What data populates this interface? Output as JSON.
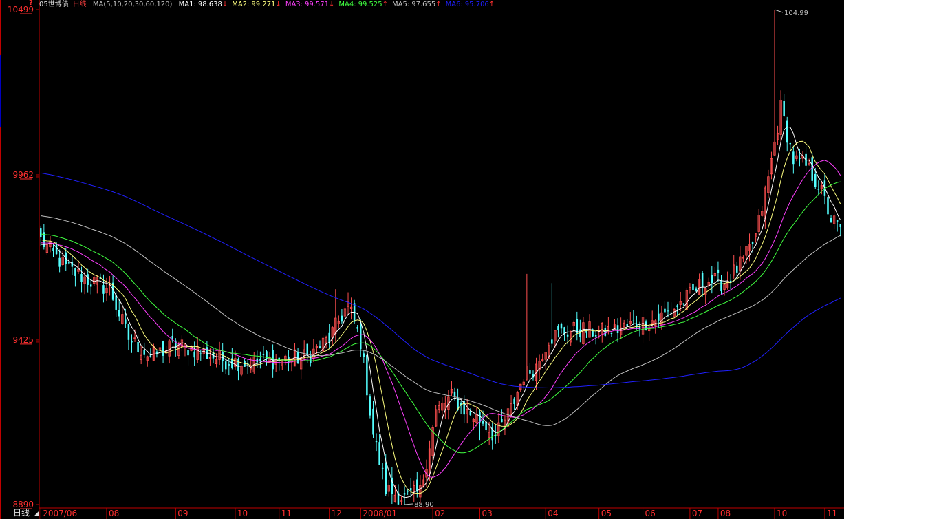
{
  "header": {
    "symbol": "05世博债",
    "period": "日线",
    "ma_label": "MA(5,10,20,30,60,120)",
    "mas": [
      {
        "label": "MA1:",
        "value": "98.638",
        "arrow": "↓",
        "color": "#ffffff"
      },
      {
        "label": "MA2:",
        "value": "99.271",
        "arrow": "↓",
        "color": "#ffff80"
      },
      {
        "label": "MA3:",
        "value": "99.571",
        "arrow": "↓",
        "color": "#ff40ff"
      },
      {
        "label": "MA4:",
        "value": "99.525",
        "arrow": "↑",
        "color": "#40ff40"
      },
      {
        "label": "MA5:",
        "value": "97.655",
        "arrow": "↑",
        "color": "#c0c0c0"
      },
      {
        "label": "MA6:",
        "value": "95.706",
        "arrow": "↑",
        "color": "#2020ff"
      }
    ]
  },
  "period_label": "日线",
  "colors": {
    "up": "#ff5050",
    "down": "#54ffff",
    "axis": "#c00000",
    "label": "#ff3030"
  },
  "chart_data": {
    "type": "candlestick",
    "y_ticks": [
      "10499",
      "9962",
      "9425",
      "8890"
    ],
    "y_tick_values": [
      104.99,
      99.62,
      94.25,
      88.9
    ],
    "ylim": [
      88.9,
      104.99
    ],
    "x_ticks": [
      {
        "label": "2007/06",
        "index": 0
      },
      {
        "label": "08",
        "index": 21
      },
      {
        "label": "09",
        "index": 43
      },
      {
        "label": "10",
        "index": 62
      },
      {
        "label": "11",
        "index": 76
      },
      {
        "label": "12",
        "index": 92
      },
      {
        "label": "2008/01",
        "index": 102
      },
      {
        "label": "02",
        "index": 125
      },
      {
        "label": "03",
        "index": 140
      },
      {
        "label": "04",
        "index": 161
      },
      {
        "label": "05",
        "index": 178
      },
      {
        "label": "06",
        "index": 192
      },
      {
        "label": "07",
        "index": 207
      },
      {
        "label": "08",
        "index": 216
      },
      {
        "label": "10",
        "index": 234
      },
      {
        "label": "11",
        "index": 250
      }
    ],
    "annotations": [
      {
        "text": "104.99",
        "index": 234,
        "value": 104.99
      },
      {
        "text": "88.90",
        "index": 116,
        "value": 88.9
      }
    ],
    "anchors": [
      [
        0,
        97.5
      ],
      [
        8,
        96.6
      ],
      [
        15,
        96.2
      ],
      [
        22,
        95.9
      ],
      [
        28,
        94.3
      ],
      [
        35,
        93.7
      ],
      [
        43,
        94.1
      ],
      [
        50,
        93.9
      ],
      [
        58,
        93.6
      ],
      [
        66,
        93.5
      ],
      [
        75,
        93.6
      ],
      [
        85,
        93.7
      ],
      [
        92,
        94.3
      ],
      [
        98,
        95.4
      ],
      [
        102,
        94.2
      ],
      [
        106,
        91.2
      ],
      [
        110,
        89.4
      ],
      [
        116,
        89.1
      ],
      [
        121,
        89.3
      ],
      [
        126,
        91.9
      ],
      [
        131,
        92.4
      ],
      [
        136,
        91.9
      ],
      [
        141,
        91.6
      ],
      [
        145,
        91.1
      ],
      [
        150,
        92.0
      ],
      [
        154,
        93.1
      ],
      [
        158,
        93.4
      ],
      [
        162,
        94.3
      ],
      [
        166,
        94.5
      ],
      [
        172,
        94.6
      ],
      [
        178,
        94.5
      ],
      [
        184,
        94.6
      ],
      [
        190,
        94.8
      ],
      [
        196,
        94.9
      ],
      [
        201,
        95.2
      ],
      [
        206,
        95.6
      ],
      [
        212,
        96.2
      ],
      [
        218,
        96.1
      ],
      [
        224,
        96.8
      ],
      [
        228,
        97.6
      ],
      [
        232,
        99.5
      ],
      [
        236,
        101.8
      ],
      [
        240,
        100.1
      ],
      [
        244,
        99.9
      ],
      [
        248,
        99.3
      ],
      [
        252,
        98.2
      ],
      [
        255,
        97.8
      ]
    ],
    "extremes": [
      [
        116,
        88.9,
        "low"
      ],
      [
        234,
        104.99,
        "high"
      ],
      [
        140,
        91.0,
        "low"
      ],
      [
        163,
        96.1,
        "high"
      ],
      [
        155,
        96.4,
        "high"
      ],
      [
        94,
        95.9,
        "high"
      ]
    ],
    "ma_periods": [
      5,
      10,
      20,
      30,
      60,
      120
    ],
    "ma_initial": [
      97.3,
      97.5,
      97.4,
      97.7,
      98.3,
      99.7
    ],
    "n_bars": 256
  }
}
